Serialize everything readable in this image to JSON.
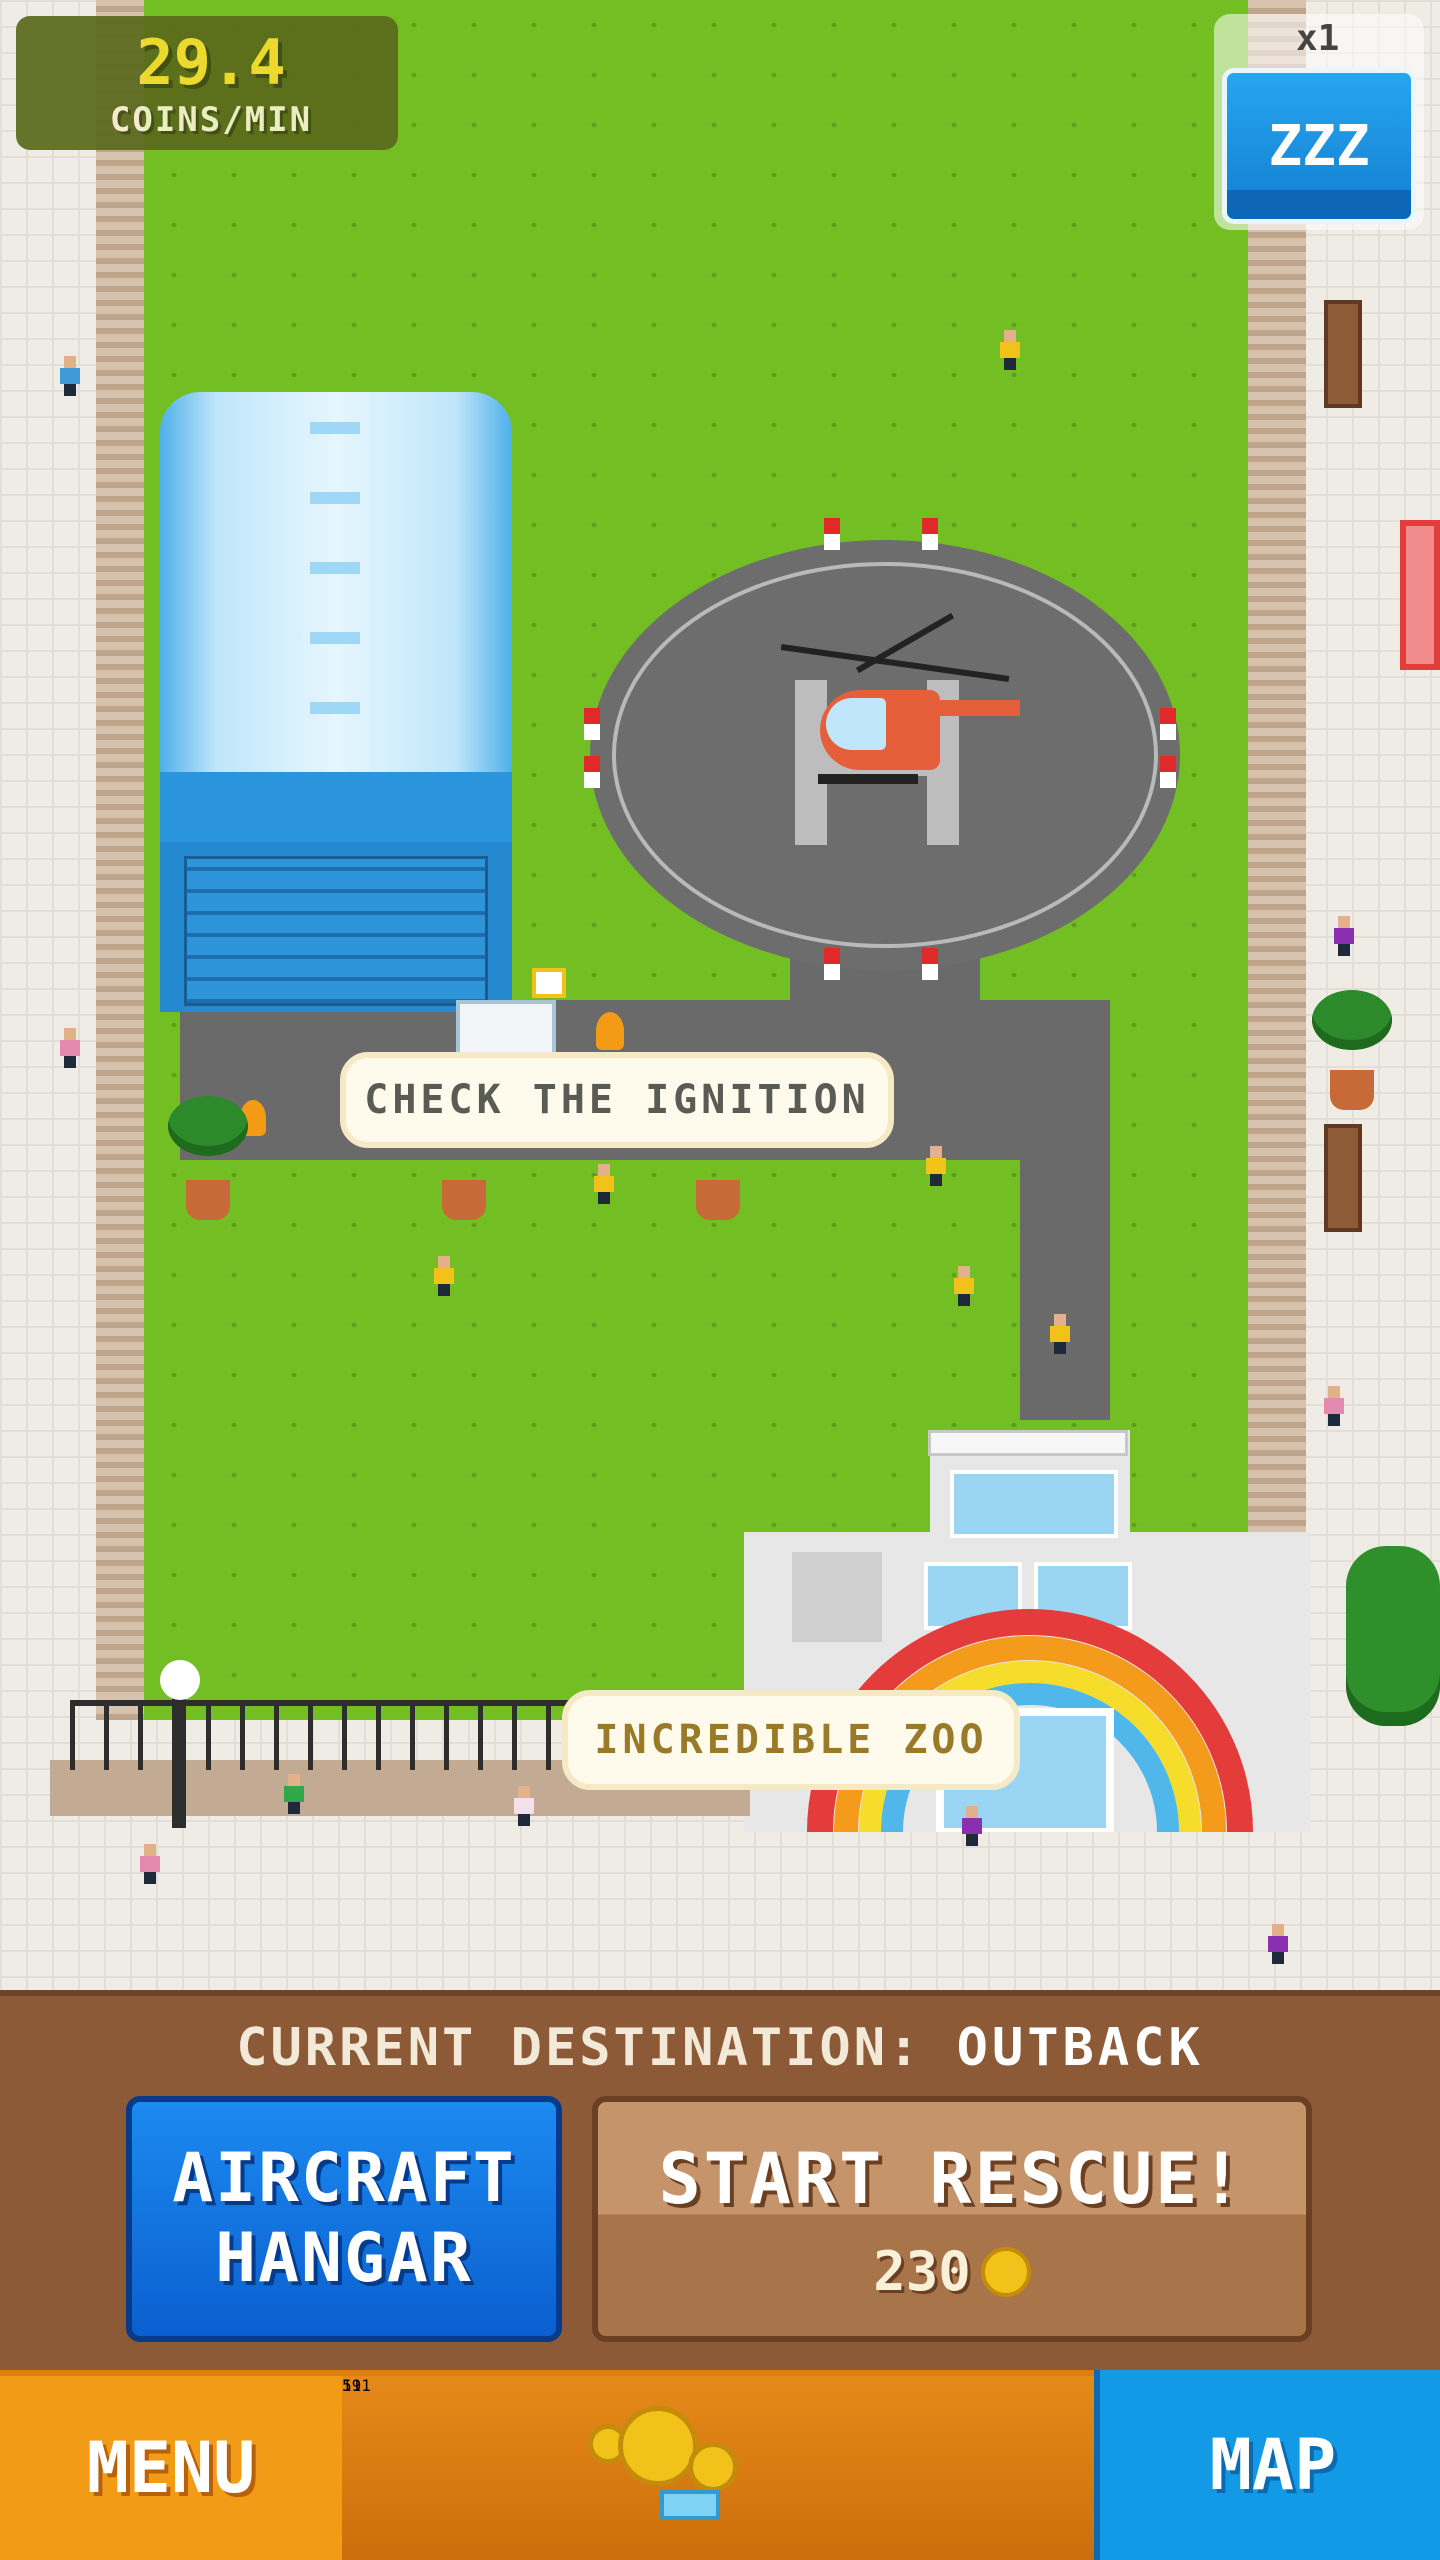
{
  "hud": {
    "rate_value": "29.4",
    "rate_unit": "COINS/MIN",
    "speed_multiplier": "x1",
    "sleep_button_label": "ZZZ"
  },
  "speech_bubbles": {
    "hangar_bubble": "CHECK THE IGNITION",
    "entrance_bubble": "INCREDIBLE ZOO"
  },
  "destination": {
    "label": "CURRENT DESTINATION:",
    "value": "OUTBACK"
  },
  "actions": {
    "hangar_line1": "AIRCRAFT",
    "hangar_line2": "HANGAR",
    "rescue_title": "START RESCUE!",
    "rescue_cost": "230"
  },
  "navbar": {
    "menu_label": "MENU",
    "map_label": "MAP",
    "coins": "591",
    "gems": "11"
  },
  "colors": {
    "grass": "#73be22",
    "hangar_blue": "#2a94dc",
    "button_blue": "#1686d8",
    "rescue_tan": "#c5946a",
    "nav_orange": "#e07c10",
    "coin_gold": "#f2c21b"
  }
}
